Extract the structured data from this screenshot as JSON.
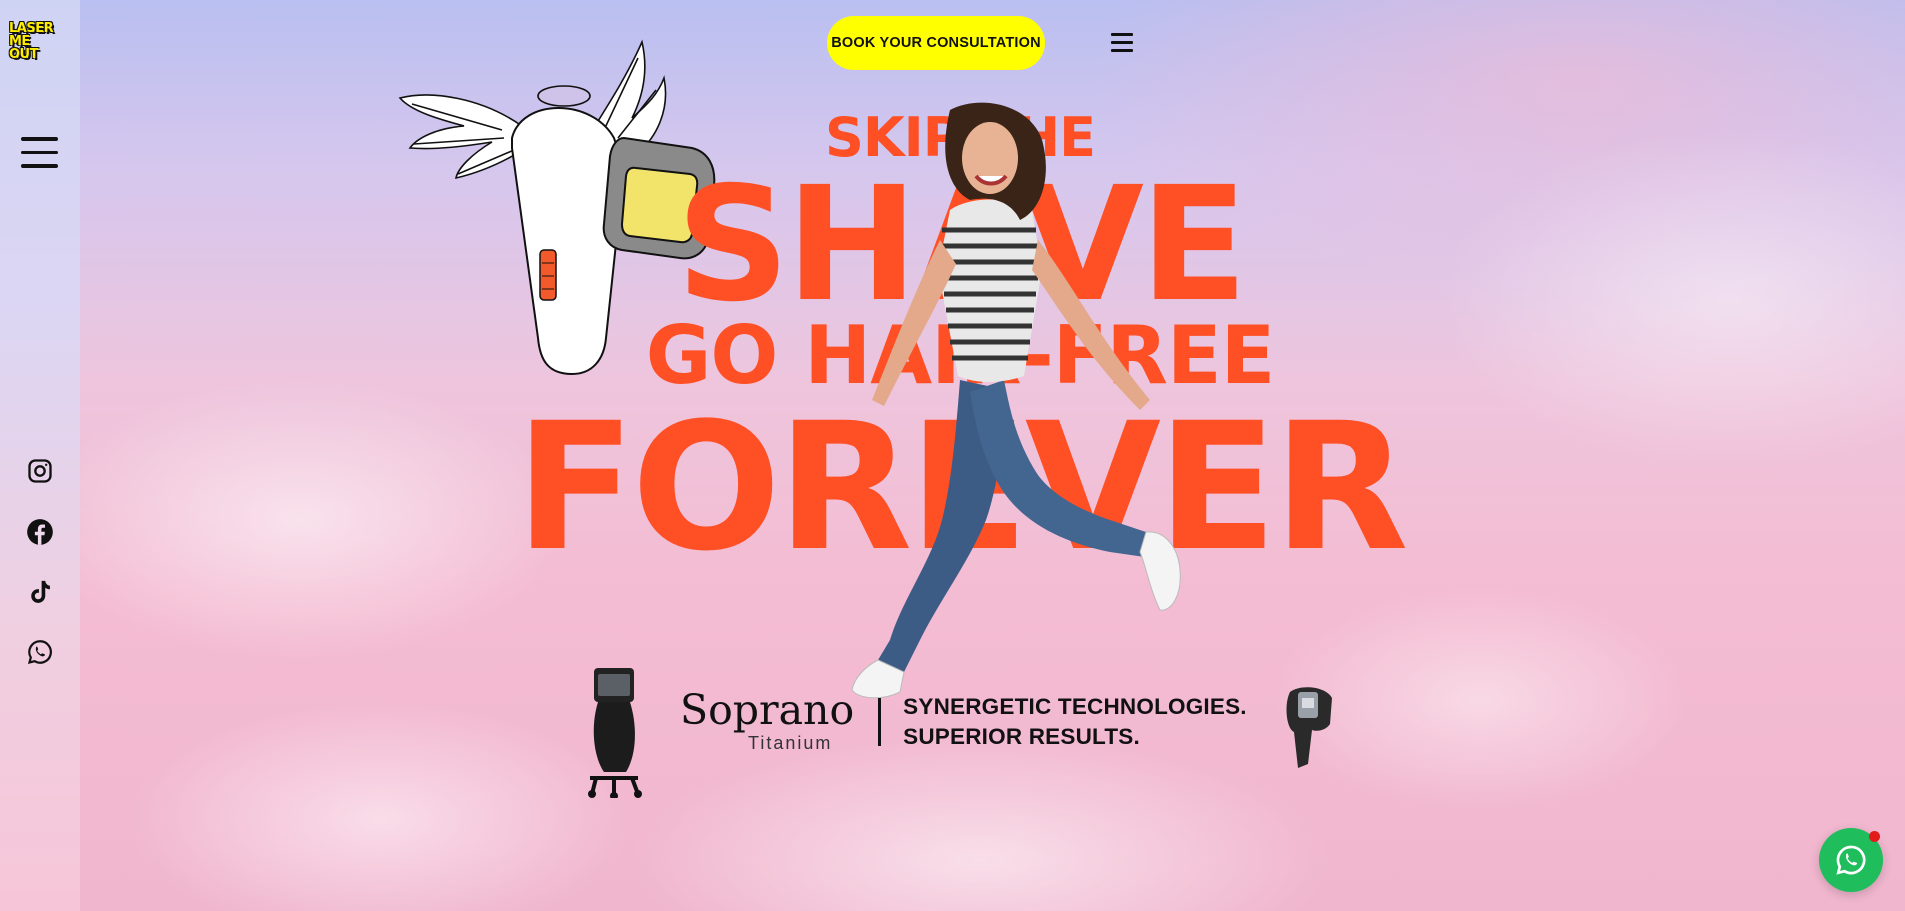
{
  "logo": {
    "lines": [
      "LASER",
      "ME",
      "OUT"
    ]
  },
  "header": {
    "cta_label": "BOOK YOUR CONSULTATION"
  },
  "headline": {
    "line1": "SKIP THE",
    "line2": "SHAVE",
    "line3": "GO HAIR-FREE",
    "line4": "FOREVER"
  },
  "brand": {
    "name": "Soprano",
    "sub": "Titanium",
    "tagline_1": "SYNERGETIC TECHNOLOGIES.",
    "tagline_2": "SUPERIOR RESULTS."
  },
  "social": [
    "instagram-icon",
    "facebook-icon",
    "tiktok-icon",
    "whatsapp-icon"
  ],
  "colors": {
    "accent": "#ff4f25",
    "cta": "#ffff00",
    "whatsapp": "#1fbd5c",
    "notification": "#e31b1b"
  }
}
